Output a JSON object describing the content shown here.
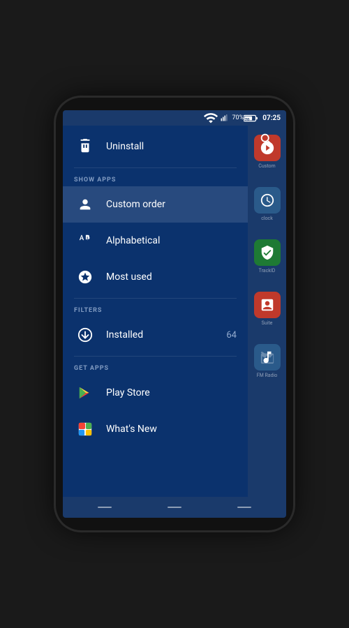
{
  "statusBar": {
    "time": "07:25",
    "battery": "70%",
    "batteryIcon": "🔋"
  },
  "menu": {
    "uninstall_label": "Uninstall",
    "showApps_section": "SHOW APPS",
    "customOrder_label": "Custom order",
    "alphabetical_label": "Alphabetical",
    "mostUsed_label": "Most used",
    "filters_section": "FILTERS",
    "installed_label": "Installed",
    "installed_count": "64",
    "getApps_section": "GET APPS",
    "playStore_label": "Play Store",
    "whatsNew_label": "What's New"
  },
  "peekApps": [
    {
      "label": "Custom",
      "color": "#3a7bd5"
    },
    {
      "label": "clock",
      "color": "#2a6099"
    },
    {
      "label": "TrackID",
      "color": "#1e5588"
    },
    {
      "label": "Suite",
      "color": "#c0392b"
    },
    {
      "label": "FM Radio",
      "color": "#1a4a77"
    }
  ]
}
